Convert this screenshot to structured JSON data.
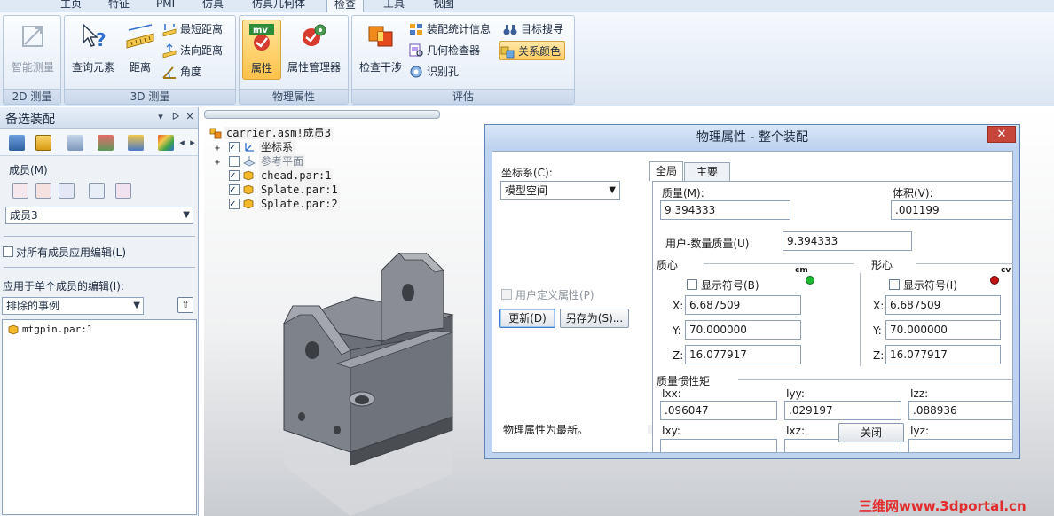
{
  "ribbon": {
    "tabs": [
      "主页",
      "特征",
      "PMI",
      "仿真",
      "仿真几何体",
      "检查",
      "工具",
      "视图"
    ],
    "active_tab": "检查",
    "groups": {
      "measure2d": {
        "label": "2D 测量",
        "smart_measure": "智能测量"
      },
      "measure3d": {
        "label": "3D 测量",
        "query_element": "查询元素",
        "distance": "距离",
        "min_distance": "最短距离",
        "normal_distance": "法向距离",
        "angle": "角度"
      },
      "physical": {
        "label": "物理属性",
        "properties": "属性",
        "property_manager": "属性管理器"
      },
      "evaluate": {
        "label": "评估",
        "interference_check": "检查干涉",
        "assembly_stats": "装配统计信息",
        "target_search": "目标搜寻",
        "geometry_inspector": "几何检查器",
        "relation_color": "关系颜色",
        "identify_holes": "识别孔"
      }
    }
  },
  "left_pane": {
    "title": "备选装配",
    "members_label": "成员(M)",
    "member_select": "成员3",
    "apply_all_label": "对所有成员应用编辑(L)",
    "apply_single_label": "应用于单个成员的编辑(I):",
    "apply_single_select": "排除的事例",
    "list_items": [
      "mtgpin.par:1"
    ]
  },
  "tree": {
    "root": "carrier.asm!成员3",
    "items": [
      {
        "label": "坐标系",
        "expander": "+",
        "checked": true
      },
      {
        "label": "参考平面",
        "expander": "+",
        "checked": false
      },
      {
        "label": "chead.par:1",
        "expander": "",
        "checked": true
      },
      {
        "label": "Splate.par:1",
        "expander": "",
        "checked": true
      },
      {
        "label": "Splate.par:2",
        "expander": "",
        "checked": true
      }
    ]
  },
  "dialog": {
    "title": "物理属性 - 整个装配",
    "close_glyph": "✕",
    "coord_label": "坐标系(C):",
    "coord_value": "模型空间",
    "user_defined_label": "用户定义属性(P)",
    "update_button": "更新(D)",
    "save_as_button": "另存为(S)...",
    "status_text": "物理属性为最新。",
    "close_button": "关闭",
    "tabs": [
      "全局",
      "主要"
    ],
    "mass_label": "质量(M):",
    "mass_value": "9.394333",
    "volume_label": "体积(V):",
    "volume_value": ".001199",
    "user_mass_label": "用户-数量质量(U):",
    "user_mass_value": "9.394333",
    "centroid": {
      "label": "质心",
      "show_symbol": "显示符号(B)",
      "symbol_tag": "cm",
      "x_label": "X:",
      "x": "6.687509",
      "y_label": "Y:",
      "y": "70.000000",
      "z_label": "Z:",
      "z": "16.077917",
      "dot_color": "#1fb832"
    },
    "shape_center": {
      "label": "形心",
      "show_symbol": "显示符号(I)",
      "symbol_tag": "cv",
      "x_label": "X:",
      "x": "6.687509",
      "y_label": "Y:",
      "y": "70.000000",
      "z_label": "Z:",
      "z": "16.077917",
      "dot_color": "#c21414"
    },
    "inertia": {
      "label": "质量惯性矩",
      "ixx_label": "Ixx:",
      "ixx": ".096047",
      "iyy_label": "Iyy:",
      "iyy": ".029197",
      "izz_label": "Izz:",
      "izz": ".088936",
      "ixy_label": "Ixy:",
      "ixz_label": "Ixz:",
      "iyz_label": "Iyz:"
    }
  },
  "watermark": "三维网www.3dportal.cn"
}
